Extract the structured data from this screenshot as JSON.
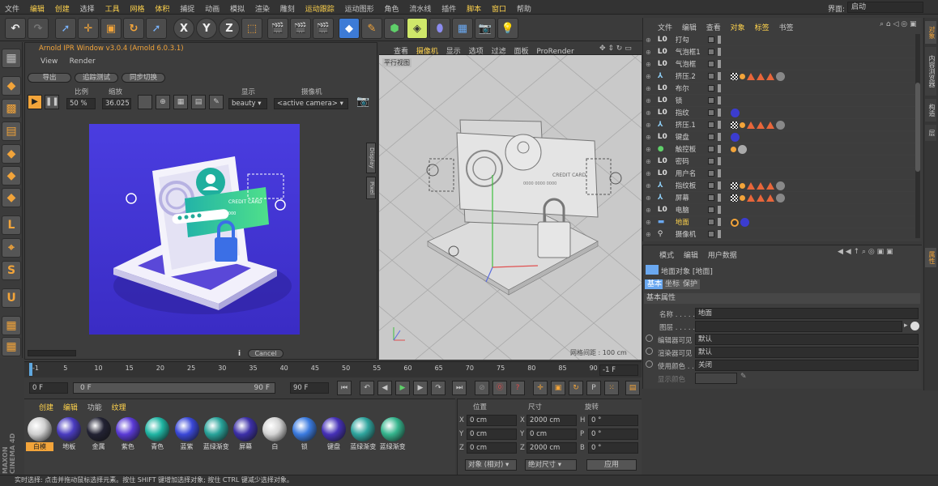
{
  "menu": {
    "items": [
      "文件",
      "编辑",
      "创建",
      "选择",
      "工具",
      "网格",
      "体积",
      "捕捉",
      "动画",
      "模拟",
      "渲染",
      "雕刻",
      "运动跟踪",
      "运动图形",
      "角色",
      "流水线",
      "插件",
      "脚本",
      "窗口",
      "帮助"
    ],
    "layout_label": "界面:",
    "layout_value": "启动"
  },
  "toolbar": {
    "x": "X",
    "y": "Y",
    "z": "Z"
  },
  "ipr": {
    "title": "Arnold IPR Window v3.0.4 (Arnold 6.0.3.1)",
    "menu_view": "View",
    "menu_render": "Render",
    "btn_export": "导出",
    "btn_trace": "追踪测试",
    "btn_sync": "同步切换",
    "lbl_ratio": "比例",
    "lbl_scale": "缩放",
    "lbl_display": "显示",
    "lbl_camera": "摄像机",
    "ratio": "50 %",
    "scale": "36.025",
    "display": "beauty",
    "camera": "<active camera>",
    "tab_display": "Display",
    "tab_pixel": "Pixel",
    "cancel": "Cancel",
    "info": "i"
  },
  "card_text": {
    "credit": "CREDIT CARD",
    "digits": "0000 0000 0000"
  },
  "viewport": {
    "menu": [
      "查看",
      "摄像机",
      "显示",
      "选项",
      "过滤",
      "面板",
      "ProRender"
    ],
    "label": "平行视图",
    "grid": "网格间距 : 100 cm"
  },
  "objmgr": {
    "menu": [
      "文件",
      "编辑",
      "查看",
      "对象",
      "标签",
      "书签"
    ],
    "rows": [
      {
        "n": "打勾",
        "t": "L0"
      },
      {
        "n": "气泡框1",
        "t": "L0"
      },
      {
        "n": "气泡框",
        "t": "L0"
      },
      {
        "n": "挤压.2",
        "t": "ext",
        "tags": "full"
      },
      {
        "n": "布尔",
        "t": "L0"
      },
      {
        "n": "锁",
        "t": "L0"
      },
      {
        "n": "指纹",
        "t": "L0",
        "tags": "blue"
      },
      {
        "n": "挤压.1",
        "t": "ext",
        "tags": "full"
      },
      {
        "n": "键盘",
        "t": "L0",
        "tags": "blue"
      },
      {
        "n": "触控板",
        "t": "grn",
        "tags": "small"
      },
      {
        "n": "密码",
        "t": "L0"
      },
      {
        "n": "用户名",
        "t": "L0"
      },
      {
        "n": "指纹板",
        "t": "ext",
        "tags": "full"
      },
      {
        "n": "屏幕",
        "t": "ext",
        "tags": "full"
      },
      {
        "n": "电脑",
        "t": "L0"
      },
      {
        "n": "地面",
        "t": "gnd",
        "tags": "floor",
        "sel": true
      },
      {
        "n": "摄像机",
        "t": "cam"
      }
    ]
  },
  "attr": {
    "menu": [
      "模式",
      "编辑",
      "用户数据"
    ],
    "title": "地面对象 [地面]",
    "tabs": [
      "基本",
      "坐标",
      "保护"
    ],
    "section": "基本属性",
    "rows": [
      {
        "l": "名称 . . . . .",
        "v": "地面"
      },
      {
        "l": "图层 . . . . .",
        "v": ""
      },
      {
        "l": "编辑器可见",
        "v": "默认"
      },
      {
        "l": "渲染器可见",
        "v": "默认"
      },
      {
        "l": "使用颜色 . .",
        "v": "关闭"
      },
      {
        "l": "显示颜色",
        "v": ""
      }
    ]
  },
  "timeline": {
    "ticks": [
      "-1",
      "5",
      "10",
      "15",
      "20",
      "25",
      "30",
      "35",
      "40",
      "45",
      "50",
      "55",
      "60",
      "65",
      "70",
      "75",
      "80",
      "85",
      "90"
    ],
    "end": "-1 F",
    "f0": "0 F",
    "f1": "0 F",
    "f2": "90 F",
    "f3": "90 F"
  },
  "matmgr": {
    "menu": [
      "创建",
      "编辑",
      "功能",
      "纹理"
    ],
    "mats": [
      {
        "n": "白模",
        "c": "#cfcfcf",
        "sel": true
      },
      {
        "n": "地板",
        "c": "#4a3cc0"
      },
      {
        "n": "金属",
        "c": "#222233"
      },
      {
        "n": "紫色",
        "c": "#5a3ad6"
      },
      {
        "n": "青色",
        "c": "#1fb5a3"
      },
      {
        "n": "蓝紫",
        "c": "#3a48d8"
      },
      {
        "n": "蓝绿渐变",
        "c": "#28a39a"
      },
      {
        "n": "屏幕",
        "c": "#3c2fa8"
      },
      {
        "n": "白",
        "c": "#d4d4d4"
      },
      {
        "n": "锁",
        "c": "#3b7be0"
      },
      {
        "n": "键盘",
        "c": "#4631b8"
      },
      {
        "n": "蓝绿渐变",
        "c": "#2fa59e"
      },
      {
        "n": "蓝绿渐变",
        "c": "#35b58d"
      }
    ]
  },
  "coords": {
    "h_pos": "位置",
    "h_size": "尺寸",
    "h_rot": "旋转",
    "rows": [
      {
        "a": "X",
        "p": "0 cm",
        "b": "X",
        "s": "2000 cm",
        "c": "H",
        "r": "0 °"
      },
      {
        "a": "Y",
        "p": "0 cm",
        "b": "Y",
        "s": "0 cm",
        "c": "P",
        "r": "0 °"
      },
      {
        "a": "Z",
        "p": "0 cm",
        "b": "Z",
        "s": "2000 cm",
        "c": "B",
        "r": "0 °"
      }
    ],
    "mode": "对象 (相对)",
    "size": "绝对尺寸",
    "apply": "应用"
  },
  "status": "实时选择: 点击并拖动鼠标选择元素。按住 SHIFT 键增加选择对象; 按住 CTRL 键减少选择对象。",
  "side_tabs": [
    "对象",
    "内容浏览器",
    "构造",
    "层"
  ],
  "attr_tab": "属性",
  "logo": {
    "a": "MAXON",
    "b": "CINEMA 4D"
  }
}
